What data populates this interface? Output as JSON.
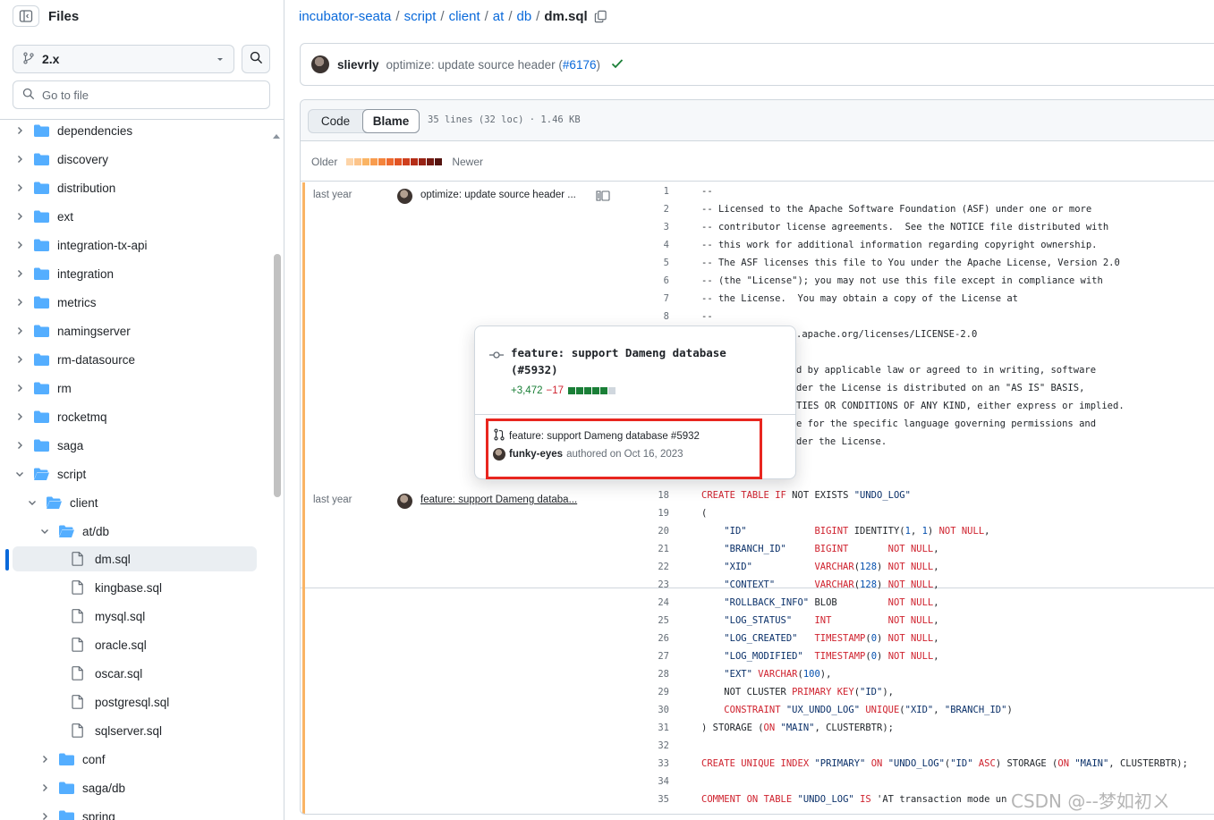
{
  "sidebar": {
    "title": "Files",
    "branch": "2.x",
    "goto_placeholder": "Go to file",
    "tree": [
      {
        "name": "dependencies",
        "type": "folder",
        "expanded": false,
        "depth": 0
      },
      {
        "name": "discovery",
        "type": "folder",
        "expanded": false,
        "depth": 0
      },
      {
        "name": "distribution",
        "type": "folder",
        "expanded": false,
        "depth": 0
      },
      {
        "name": "ext",
        "type": "folder",
        "expanded": false,
        "depth": 0
      },
      {
        "name": "integration-tx-api",
        "type": "folder",
        "expanded": false,
        "depth": 0
      },
      {
        "name": "integration",
        "type": "folder",
        "expanded": false,
        "depth": 0
      },
      {
        "name": "metrics",
        "type": "folder",
        "expanded": false,
        "depth": 0
      },
      {
        "name": "namingserver",
        "type": "folder",
        "expanded": false,
        "depth": 0
      },
      {
        "name": "rm-datasource",
        "type": "folder",
        "expanded": false,
        "depth": 0
      },
      {
        "name": "rm",
        "type": "folder",
        "expanded": false,
        "depth": 0
      },
      {
        "name": "rocketmq",
        "type": "folder",
        "expanded": false,
        "depth": 0
      },
      {
        "name": "saga",
        "type": "folder",
        "expanded": false,
        "depth": 0
      },
      {
        "name": "script",
        "type": "folder",
        "expanded": true,
        "depth": 0
      },
      {
        "name": "client",
        "type": "folder",
        "expanded": true,
        "depth": 1
      },
      {
        "name": "at/db",
        "type": "folder",
        "expanded": true,
        "depth": 2
      },
      {
        "name": "dm.sql",
        "type": "file",
        "selected": true,
        "depth": 3
      },
      {
        "name": "kingbase.sql",
        "type": "file",
        "depth": 3
      },
      {
        "name": "mysql.sql",
        "type": "file",
        "depth": 3
      },
      {
        "name": "oracle.sql",
        "type": "file",
        "depth": 3
      },
      {
        "name": "oscar.sql",
        "type": "file",
        "depth": 3
      },
      {
        "name": "postgresql.sql",
        "type": "file",
        "depth": 3
      },
      {
        "name": "sqlserver.sql",
        "type": "file",
        "depth": 3
      },
      {
        "name": "conf",
        "type": "folder",
        "expanded": false,
        "depth": 2
      },
      {
        "name": "saga/db",
        "type": "folder",
        "expanded": false,
        "depth": 2
      },
      {
        "name": "spring",
        "type": "folder",
        "expanded": false,
        "depth": 2
      }
    ]
  },
  "breadcrumb": {
    "repo": "incubator-seata",
    "parts": [
      "script",
      "client",
      "at",
      "db"
    ],
    "file": "dm.sql"
  },
  "latest_commit": {
    "author": "slievrly",
    "message": "optimize: update source header (",
    "pr": "#6176",
    "message_end": ")"
  },
  "file": {
    "tab_code": "Code",
    "tab_blame": "Blame",
    "meta": "35 lines (32 loc) · 1.46 KB",
    "age_older": "Older",
    "age_newer": "Newer"
  },
  "blame_groups": [
    {
      "age": "last year",
      "message": "optimize: update source header ..."
    },
    {
      "age": "last year",
      "message": "feature: support Dameng databa..."
    }
  ],
  "popover": {
    "title": "feature: support Dameng database (#5932)",
    "additions": "+3,472",
    "deletions": "−17",
    "pr_text": "feature: support Dameng database #5932",
    "author": "funky-eyes",
    "authored": "authored on Oct 16, 2023"
  },
  "code_lines": [
    {
      "n": 1,
      "t": "--"
    },
    {
      "n": 2,
      "t": "-- Licensed to the Apache Software Foundation (ASF) under one or more"
    },
    {
      "n": 3,
      "t": "-- contributor license agreements.  See the NOTICE file distributed with"
    },
    {
      "n": 4,
      "t": "-- this work for additional information regarding copyright ownership."
    },
    {
      "n": 5,
      "t": "-- The ASF licenses this file to You under the Apache License, Version 2.0"
    },
    {
      "n": 6,
      "t": "-- (the \"License\"); you may not use this file except in compliance with"
    },
    {
      "n": 7,
      "t": "-- the License.  You may obtain a copy of the License at"
    },
    {
      "n": 8,
      "t": "--"
    },
    {
      "n": 9,
      "t": ".apache.org/licenses/LICENSE-2.0"
    },
    {
      "n": 11,
      "t": "d by applicable law or agreed to in writing, software"
    },
    {
      "n": 12,
      "t": "der the License is distributed on an \"AS IS\" BASIS,"
    },
    {
      "n": 13,
      "t": "TIES OR CONDITIONS OF ANY KIND, either express or implied."
    },
    {
      "n": 14,
      "t": "e for the specific language governing permissions and"
    },
    {
      "n": 15,
      "t": "der the License."
    },
    {
      "n": 18,
      "t": "CREATE TABLE IF NOT EXISTS \"UNDO_LOG\""
    },
    {
      "n": 19,
      "t": "("
    },
    {
      "n": 20,
      "t": "    \"ID\"            BIGINT IDENTITY(1, 1) NOT NULL,"
    },
    {
      "n": 21,
      "t": "    \"BRANCH_ID\"     BIGINT       NOT NULL,"
    },
    {
      "n": 22,
      "t": "    \"XID\"           VARCHAR(128) NOT NULL,"
    },
    {
      "n": 23,
      "t": "    \"CONTEXT\"       VARCHAR(128) NOT NULL,"
    },
    {
      "n": 24,
      "t": "    \"ROLLBACK_INFO\" BLOB         NOT NULL,"
    },
    {
      "n": 25,
      "t": "    \"LOG_STATUS\"    INT          NOT NULL,"
    },
    {
      "n": 26,
      "t": "    \"LOG_CREATED\"   TIMESTAMP(0) NOT NULL,"
    },
    {
      "n": 27,
      "t": "    \"LOG_MODIFIED\"  TIMESTAMP(0) NOT NULL,"
    },
    {
      "n": 28,
      "t": "    \"EXT\" VARCHAR(100),"
    },
    {
      "n": 29,
      "t": "    NOT CLUSTER PRIMARY KEY(\"ID\"),"
    },
    {
      "n": 30,
      "t": "    CONSTRAINT \"UX_UNDO_LOG\" UNIQUE(\"XID\", \"BRANCH_ID\")"
    },
    {
      "n": 31,
      "t": ") STORAGE (ON \"MAIN\", CLUSTERBTR);"
    },
    {
      "n": 32,
      "t": ""
    },
    {
      "n": 33,
      "t": "CREATE UNIQUE INDEX \"PRIMARY\" ON \"UNDO_LOG\"(\"ID\" ASC) STORAGE (ON \"MAIN\", CLUSTERBTR);"
    },
    {
      "n": 34,
      "t": ""
    },
    {
      "n": 35,
      "t": "COMMENT ON TABLE \"UNDO_LOG\" IS 'AT transaction mode un"
    }
  ],
  "watermark": "CSDN @--梦如初ㄨ",
  "colors": {
    "accent": "#0969da",
    "highlight_box": "#e8261f",
    "age_accent": "#fab464",
    "additions": "#1a7f37",
    "deletions": "#cf222e"
  },
  "age_scale_colors": [
    "#fdd4a8",
    "#fcc48a",
    "#fab464",
    "#f89c4e",
    "#f4843c",
    "#ee6a2f",
    "#e25424",
    "#cf3f1d",
    "#b52d17",
    "#972214",
    "#741a12",
    "#551410"
  ],
  "diff_bars": [
    "add",
    "add",
    "add",
    "add",
    "add",
    "neutral"
  ]
}
